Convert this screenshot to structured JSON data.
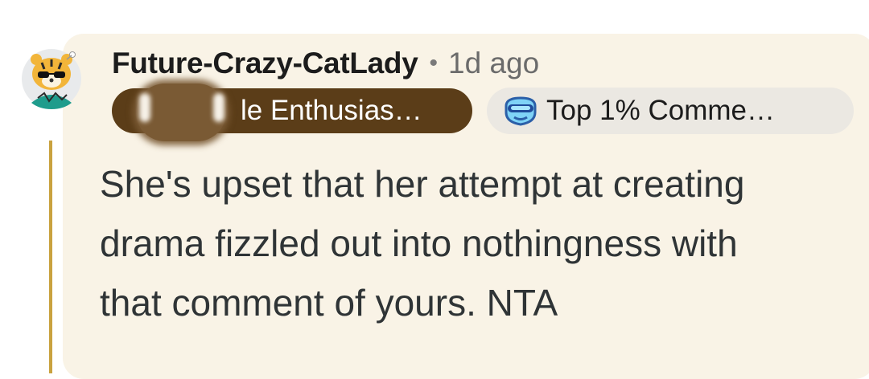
{
  "comment": {
    "username": "Future-Crazy-CatLady",
    "separator": "•",
    "timestamp": "1d ago",
    "user_flair": "le Enthusias…",
    "award_flair": "Top 1% Comme…",
    "body_lines": [
      "She's upset that her attempt at creating",
      "drama fizzled out into nothingness with",
      "that comment of yours. NTA"
    ]
  },
  "icons": {
    "avatar": "tiger-snoo-avatar-icon",
    "badge": "top-commenter-badge-icon"
  },
  "colors": {
    "card_background": "#f9f3e6",
    "thread_line": "#c9a23f",
    "user_flair_background": "#5b3d18",
    "award_flair_background": "#ebe8e2",
    "body_text": "#2f3436"
  }
}
